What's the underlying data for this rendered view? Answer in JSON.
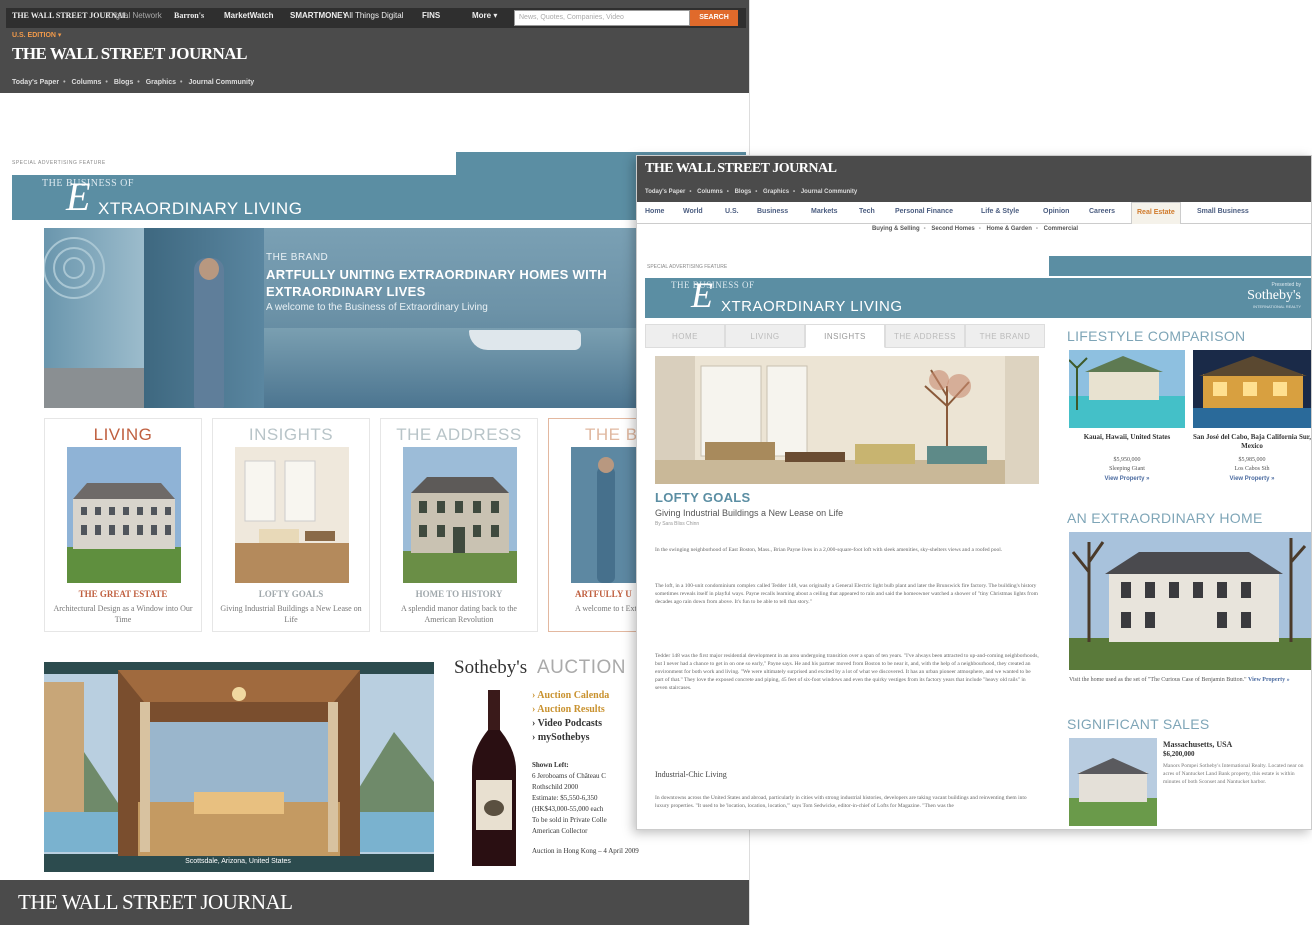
{
  "left": {
    "topbar": {
      "brand": "THE WALL STREET JOURNAL",
      "brand_tag": "Digital Network",
      "network": [
        "Barron's",
        "MarketWatch",
        "SMARTMONEY",
        "All Things Digital",
        "FINS",
        "More"
      ],
      "search_placeholder": "News, Quotes, Companies, Video",
      "search_button": "SEARCH",
      "edition": "U.S. EDITION",
      "masthead": "THE WALL STREET JOURNAL",
      "nav": [
        "Today's Paper",
        "Columns",
        "Blogs",
        "Graphics",
        "Journal Community"
      ]
    },
    "special_label": "SPECIAL ADVERTISING FEATURE",
    "banner": {
      "small": "THE BUSINESS OF",
      "script": "E",
      "big": "XTRAORDINARY LIVING"
    },
    "hero": {
      "kicker": "THE BRAND",
      "headline": "ARTFULLY UNITING EXTRAORDINARY HOMES WITH EXTRAORDINARY LIVES",
      "sub": "A welcome to the Business of Extraordinary Living"
    },
    "cards": [
      {
        "title": "LIVING",
        "heading": "THE GREAT ESTATE",
        "desc": "Architectural Design as a Window into Our Time"
      },
      {
        "title": "INSIGHTS",
        "heading": "LOFTY GOALS",
        "desc": "Giving Industrial Buildings a New Lease on Life"
      },
      {
        "title": "THE ADDRESS",
        "heading": "HOME TO HISTORY",
        "desc": "A splendid manor dating back to the American Revolution"
      },
      {
        "title": "THE BR",
        "heading": "ARTFULLY U",
        "desc": "A welcome to t Extraordin"
      }
    ],
    "auction": {
      "caption": "Scottsdale, Arizona, United States",
      "brand": "Sotheby's",
      "title": "AUCTION",
      "links": [
        "Auction Calenda",
        "Auction Results",
        "Video Podcasts",
        "mySothebys"
      ],
      "lines": [
        "Shown Left:",
        "6 Jeroboams of Château C",
        "Rothschild 2000",
        "Estimate: $5,550-6,350",
        "(HK$43,000-55,000 each",
        "To be sold in Private Colle",
        "American Collector",
        "Auction in Hong Kong – 4 April 2009"
      ]
    },
    "footer_masthead": "THE WALL STREET JOURNAL"
  },
  "right": {
    "masthead": "THE WALL STREET JOURNAL",
    "navtop": [
      "Today's Paper",
      "Columns",
      "Blogs",
      "Graphics",
      "Journal Community"
    ],
    "nav": [
      "Home",
      "World",
      "U.S.",
      "Business",
      "Markets",
      "Tech",
      "Personal Finance",
      "Life & Style",
      "Opinion",
      "Careers",
      "Real Estate",
      "Small Business"
    ],
    "subnav": [
      "Buying & Selling",
      "Second Homes",
      "Home & Garden",
      "Commercial"
    ],
    "special_label": "SPECIAL ADVERTISING FEATURE",
    "banner": {
      "small": "THE BUSINESS OF",
      "script": "E",
      "big": "XTRAORDINARY LIVING"
    },
    "presented_by": "Presented by",
    "sponsor": "Sotheby's",
    "sponsor_sub": "INTERNATIONAL REALTY",
    "tabs": [
      "HOME",
      "LIVING",
      "INSIGHTS",
      "THE ADDRESS",
      "THE BRAND"
    ],
    "article": {
      "title": "LOFTY GOALS",
      "subtitle": "Giving Industrial Buildings a New Lease on Life",
      "byline": "By Sara Bliss Chinn",
      "p1": "In the swinging neighborhood of East Boston, Mass., Brian Payne lives in a 2,000-square-foot loft with sleek amenities, sky-shelters views and a roofed pool.",
      "p2": "The loft, in a 100-unit condominium complex called Tedder 148, was originally a General Electric light bulb plant and later the Brunswick fire factory. The building's history sometimes reveals itself in playful ways. Payne recalls learning about a ceiling that appeared to rain and said the homeowner watched a shower of \"tiny Christmas lights from decades ago rain down from above. It's fun to be able to tell that story.\"",
      "p3": "Tedder 148 was the first major residential development in an area undergoing transition over a span of ten years. \"I've always been attracted to up-and-coming neighborhoods, but I never had a chance to get in on one so early,\" Payne says. He and his partner moved from Boston to be near it, and, with the help of a neighbourhood, they created an environment for both work and living. \"We were ultimately surprised and excited by a lot of what we discovered. It has an urban pioneer atmosphere, and we wanted to be part of that.\" They love the exposed concrete and piping, 45 feet of six-foot windows and even the quirky vestiges from its factory years that include \"heavy old rails\" in seven staircases.",
      "h2": "Industrial-Chic Living",
      "p4": "In downtowns across the United States and abroad, particularly in cities with strong industrial histories, developers are taking vacant buildings and reinventing them into luxury properties. \"It used to be 'location, location, location,'\" says Tom Sedwicke, editor-in-chief of Lofts for Magazine. \"Then was the"
    },
    "sidebar": {
      "lifestyle_head": "LIFESTYLE COMPARISON",
      "prop1": {
        "title": "Kauai, Hawaii, United States",
        "price": "$5,950,000",
        "agent": "Sleeping Giant",
        "link": "View Property »"
      },
      "prop2": {
        "title": "San José del Cabo, Baja California Sur, Mexico",
        "price": "$5,985,000",
        "agent": "Los Cabos Sth",
        "link": "View Property »"
      },
      "extra_head": "AN EXTRAORDINARY HOME",
      "extra_caption": "Visit the home used as the set of \"The Curious Case of Benjamin Button.\"",
      "extra_link": "View Property »",
      "sales_head": "SIGNIFICANT SALES",
      "sale_title": "Massachusetts, USA",
      "sale_price": "$6,200,000",
      "sale_text": "Manors Pompei Sotheby's International Realty. Located near on acres of Nantucket Land Bank property, this estate is within minutes of both Sconset and Nantucket harbor."
    }
  },
  "colors": {
    "teal": "#5b8ea3",
    "dark": "#4b4b4b",
    "orange": "#e06a2b",
    "gold": "#c9922f"
  }
}
